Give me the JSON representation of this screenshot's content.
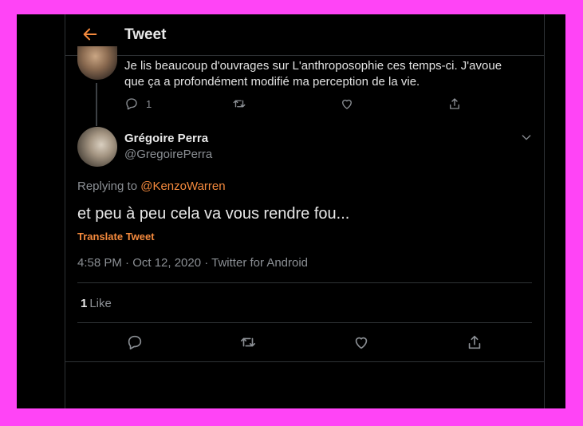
{
  "header": {
    "title": "Tweet"
  },
  "parent": {
    "text": "Je lis beaucoup d'ouvrages sur L'anthroposophie ces temps-ci. J'avoue que ça a profondément modifié ma perception de la vie.",
    "reply_count": "1"
  },
  "tweet": {
    "name": "Grégoire Perra",
    "handle": "@GregoirePerra",
    "replying_prefix": "Replying to",
    "replying_to": "@KenzoWarren",
    "text": "et peu à peu cela va vous rendre fou...",
    "translate_label": "Translate Tweet",
    "meta": "4:58 PM · Oct 12, 2020 · Twitter for Android",
    "like_count": "1",
    "like_label": "Like"
  },
  "colors": {
    "accent": "#f58a3d",
    "background": "#000000",
    "frame": "#ff44f6",
    "secondary_text": "#8b8f94"
  },
  "icons": [
    "back-arrow-icon",
    "reply-icon",
    "retweet-icon",
    "like-icon",
    "share-icon",
    "chevron-down-icon"
  ]
}
